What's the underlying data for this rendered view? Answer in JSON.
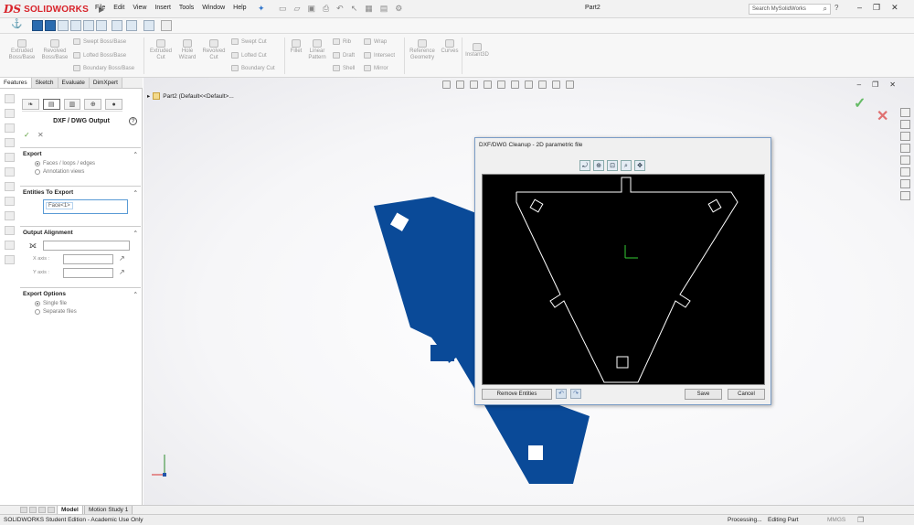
{
  "app": {
    "brand": "SOLIDWORKS",
    "document_title": "Part2",
    "search_placeholder": "Search MySolidWorks",
    "help_label": "?"
  },
  "menu": [
    "File",
    "Edit",
    "View",
    "Insert",
    "Tools",
    "Window",
    "Help"
  ],
  "ribbon": {
    "extruded_boss": "Extruded\nBoss/Base",
    "revolved_boss": "Revolved\nBoss/Base",
    "swept_boss": "Swept Boss/Base",
    "lofted_boss": "Lofted Boss/Base",
    "boundary_boss": "Boundary Boss/Base",
    "extruded_cut": "Extruded\nCut",
    "hole_wizard": "Hole\nWizard",
    "revolved_cut": "Revolved\nCut",
    "swept_cut": "Swept Cut",
    "lofted_cut": "Lofted Cut",
    "boundary_cut": "Boundary Cut",
    "fillet": "Fillet",
    "linear_pattern": "Linear\nPattern",
    "rib": "Rib",
    "draft": "Draft",
    "shell": "Shell",
    "wrap": "Wrap",
    "intersect": "Intersect",
    "mirror": "Mirror",
    "reference_geometry": "Reference\nGeometry",
    "curves": "Curves",
    "instant3d": "Instant3D"
  },
  "tabs": [
    "Features",
    "Sketch",
    "Evaluate",
    "DimXpert"
  ],
  "property_manager": {
    "title": "DXF / DWG Output",
    "export": {
      "header": "Export",
      "options": [
        {
          "label": "Faces / loops / edges",
          "selected": true
        },
        {
          "label": "Annotation views",
          "selected": false
        }
      ]
    },
    "entities": {
      "header": "Entities To Export",
      "item": "Face<1>"
    },
    "alignment": {
      "header": "Output Alignment",
      "x_axis": "X axis :",
      "y_axis": "Y axis :"
    },
    "export_options": {
      "header": "Export Options",
      "options": [
        {
          "label": "Single file",
          "selected": true
        },
        {
          "label": "Separate files",
          "selected": false
        }
      ]
    }
  },
  "tree": {
    "item": "Part2  (Default<<Default>..."
  },
  "dialog": {
    "title": "DXF/DWG Cleanup - 2D parametric file",
    "remove_entities": "Remove Entities",
    "save": "Save",
    "cancel": "Cancel"
  },
  "bottom_tabs": [
    "Model",
    "Motion Study 1"
  ],
  "status": {
    "edition": "SOLIDWORKS Student Edition - Academic Use Only",
    "processing": "Processing...",
    "mode": "Editing Part",
    "units": "MMGS"
  },
  "colors": {
    "part_blue": "#0a4a98",
    "brand_red": "#d8232a",
    "cleanup_line": "#ffffff"
  }
}
